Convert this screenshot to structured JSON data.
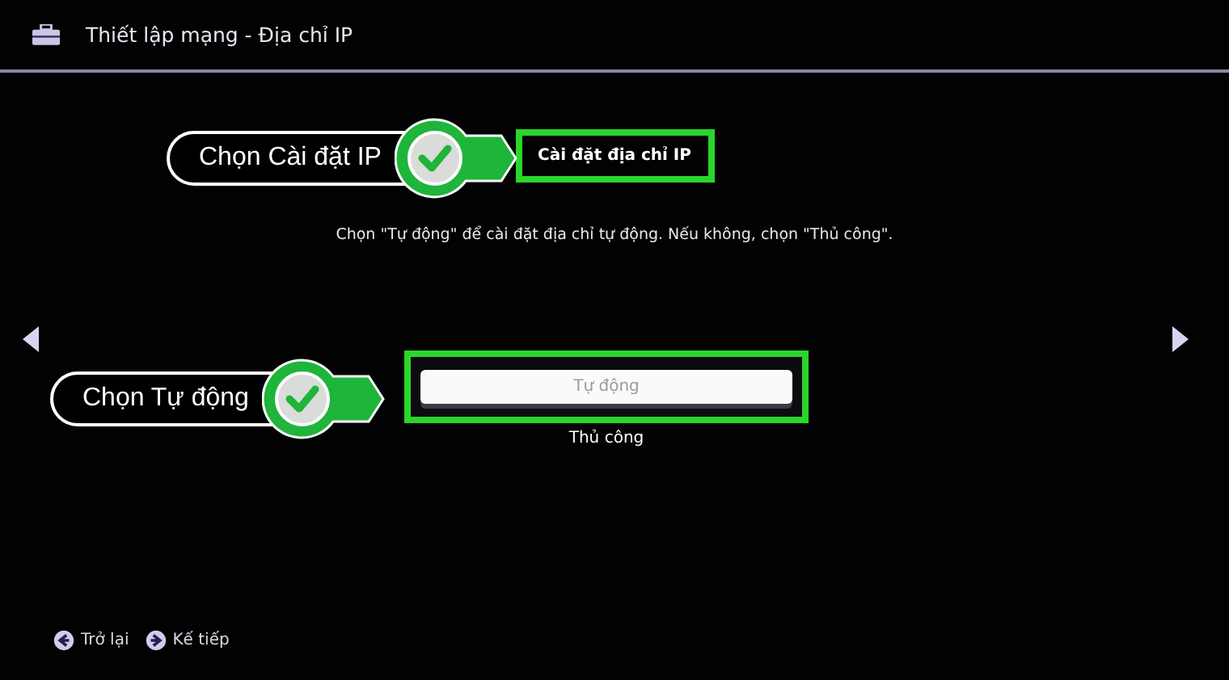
{
  "header": {
    "title": "Thiết lập mạng - Địa chỉ IP"
  },
  "section": {
    "label": "Cài đặt địa chỉ IP"
  },
  "description": "Chọn \"Tự động\" để cài đặt địa chỉ tự động. Nếu không, chọn \"Thủ công\".",
  "options": [
    {
      "label": "Tự động",
      "selected": true
    },
    {
      "label": "Thủ công",
      "selected": false
    }
  ],
  "footer": [
    {
      "kind": "back",
      "label": "Trở lại"
    },
    {
      "kind": "next",
      "label": "Kế tiếp"
    }
  ],
  "annotations": [
    {
      "text": "Chọn Cài đặt IP"
    },
    {
      "text": "Chọn Tự động"
    }
  ]
}
